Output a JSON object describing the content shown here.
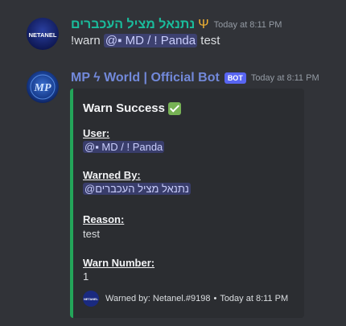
{
  "message1": {
    "username": "נתנאל מציל העכברים",
    "trident_glyph": "Ψ",
    "timestamp": "Today at 8:11 PM",
    "avatar_text": "NETANEL",
    "command": "!warn ",
    "mention": "@▪ MD / ! Panda",
    "reason_arg": " test"
  },
  "message2": {
    "username": "MP ϟ World | Official Bot",
    "bot_tag": "BOT",
    "timestamp": "Today at 8:11 PM",
    "avatar_text": "MP",
    "embed": {
      "accent_color": "#23a559",
      "title": "Warn Success",
      "title_icon": "check-mark-icon",
      "fields": [
        {
          "name": "User:",
          "value": "@▪ MD / ! Panda",
          "is_mention": true
        },
        {
          "name": "Warned By:",
          "value": "@נתנאל מציל העכברים",
          "is_mention": true
        },
        {
          "name": "Reason:",
          "value": "test",
          "is_mention": false
        },
        {
          "name": "Warn Number:",
          "value": "1",
          "is_mention": false
        }
      ],
      "footer": {
        "text": "Warned by: Netanel.#9198",
        "separator": "•",
        "timestamp": "Today at 8:11 PM"
      }
    }
  },
  "colors": {
    "background": "#313338",
    "embed_background": "#2b2d31",
    "username1": "#1abc9c",
    "username2": "#7289da",
    "bot_tag": "#5865f2",
    "mention_bg": "rgba(88,101,242,0.3)"
  }
}
